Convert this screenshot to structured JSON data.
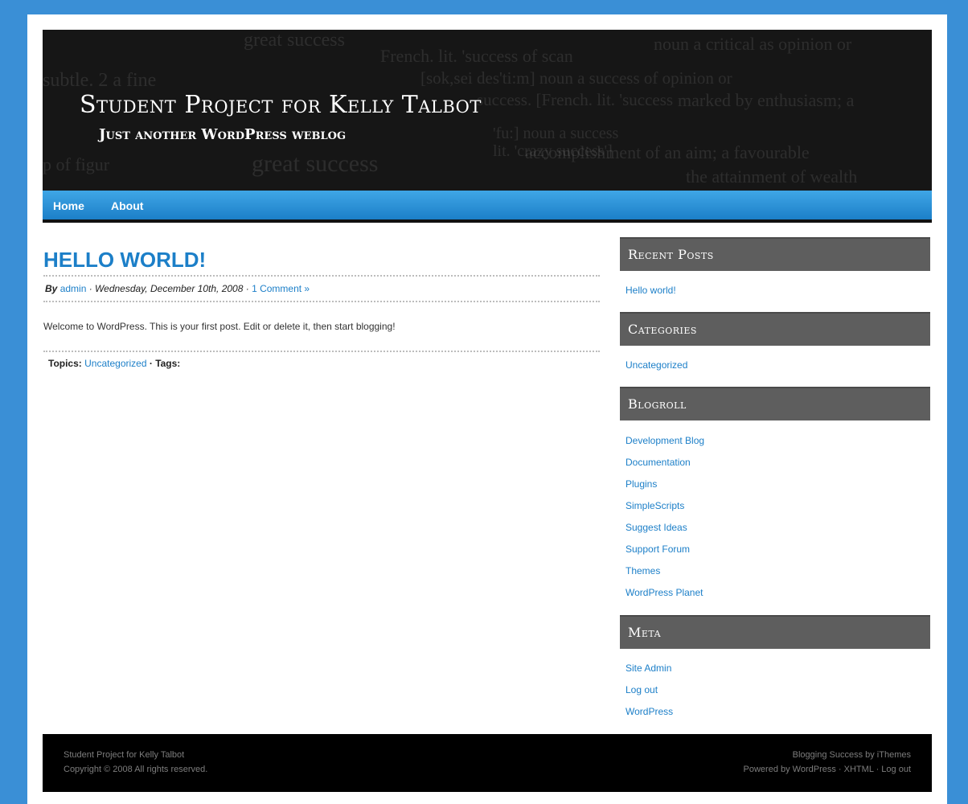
{
  "site": {
    "title": "Student Project for Kelly Talbot",
    "tagline": "Just another WordPress weblog"
  },
  "header_bg_text": [
    "subtle. 2 a fine",
    "great success",
    "French. lit. 'success of scan",
    "noun a critical as opinion or",
    "[sok,sei des'ti:m] noun a success of opinion or",
    "success. [French. lit. 'success",
    "marked by enthusiasm; a",
    "'fu:] noun a success",
    "lit. 'crazy success']",
    "accomplishment of an aim; a favourable",
    "the attainment of wealth",
    "great success",
    "p of figur"
  ],
  "nav": {
    "items": [
      "Home",
      "About"
    ]
  },
  "post": {
    "title": "HELLO WORLD!",
    "meta_by": "By",
    "meta_author": "admin",
    "meta_date": "· Wednesday, December 10th, 2008 ·",
    "meta_comments": "1 Comment »",
    "content": "Welcome to WordPress. This is your first post. Edit or delete it, then start blogging!",
    "topics_label": "Topics:",
    "topics_value": "Uncategorized",
    "tags_label": "· Tags:"
  },
  "sidebar": {
    "recent_posts": {
      "title": "Recent Posts",
      "items": [
        "Hello world!"
      ]
    },
    "categories": {
      "title": "Categories",
      "items": [
        "Uncategorized"
      ]
    },
    "blogroll": {
      "title": "Blogroll",
      "items": [
        "Development Blog",
        "Documentation",
        "Plugins",
        "SimpleScripts",
        "Suggest Ideas",
        "Support Forum",
        "Themes",
        "WordPress Planet"
      ]
    },
    "meta": {
      "title": "Meta",
      "items": [
        "Site Admin",
        "Log out",
        "WordPress"
      ]
    }
  },
  "footer": {
    "left_line1": "Student Project for Kelly Talbot",
    "left_line2": "Copyright © 2008 All rights reserved.",
    "right_line1": "Blogging Success by iThemes",
    "right_line2": "Powered by WordPress · XHTML · Log out"
  },
  "colors": {
    "page_background": "#3a8fd6",
    "accent_blue": "#1c7fc8",
    "widget_header": "#5e5e5e",
    "footer": "#000000"
  }
}
